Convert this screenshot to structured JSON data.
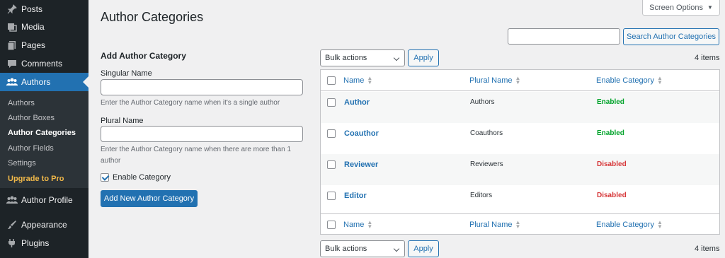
{
  "sidebar": {
    "items": [
      {
        "label": "Posts",
        "icon": "pin-icon"
      },
      {
        "label": "Media",
        "icon": "media-icon"
      },
      {
        "label": "Pages",
        "icon": "pages-icon"
      },
      {
        "label": "Comments",
        "icon": "comments-icon"
      },
      {
        "label": "Authors",
        "icon": "users-icon"
      },
      {
        "label": "Author Profile",
        "icon": "users-icon"
      },
      {
        "label": "Appearance",
        "icon": "brush-icon"
      },
      {
        "label": "Plugins",
        "icon": "plug-icon"
      }
    ],
    "submenu": [
      "Authors",
      "Author Boxes",
      "Author Categories",
      "Author Fields",
      "Settings",
      "Upgrade to Pro"
    ],
    "active_color": "#2271b1",
    "pro_color": "#f0b849"
  },
  "header": {
    "screen_options": "Screen Options",
    "title": "Author Categories",
    "search_button": "Search Author Categories"
  },
  "form": {
    "title": "Add Author Category",
    "singular_label": "Singular Name",
    "singular_help": "Enter the Author Category name when it's a single author",
    "plural_label": "Plural Name",
    "plural_help": "Enter the Author Category name when there are more than 1 author",
    "enable_label": "Enable Category",
    "enable_checked": true,
    "submit": "Add New Author Category"
  },
  "table": {
    "bulk_actions": "Bulk actions",
    "apply": "Apply",
    "items_count": "4 items",
    "columns": [
      "Name",
      "Plural Name",
      "Enable Category"
    ],
    "rows": [
      {
        "name": "Author",
        "plural": "Authors",
        "status": "Enabled"
      },
      {
        "name": "Coauthor",
        "plural": "Coauthors",
        "status": "Enabled"
      },
      {
        "name": "Reviewer",
        "plural": "Reviewers",
        "status": "Disabled"
      },
      {
        "name": "Editor",
        "plural": "Editors",
        "status": "Disabled"
      }
    ]
  }
}
